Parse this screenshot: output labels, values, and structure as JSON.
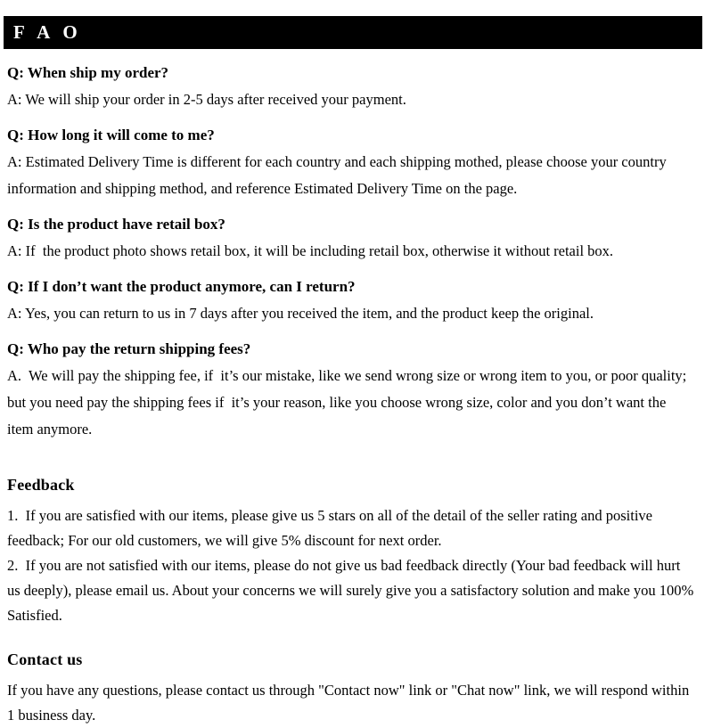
{
  "banner": {
    "title": "F A O",
    "background_color": "#000000",
    "text_color": "#ffffff"
  },
  "faq": {
    "items": [
      {
        "question": "Q: When ship my order?",
        "answer": "A: We will ship your order in 2-5 days after received your payment."
      },
      {
        "question": "Q: How long it will come to me?",
        "answer": "A: Estimated Delivery Time is different for each country and each shipping mothed, please choose your country information and shipping method, and reference Estimated Delivery Time on the page."
      },
      {
        "question": "Q: Is the product have retail box?",
        "answer": "A: If  the product photo shows retail box, it will be including retail box, otherwise it without retail box."
      },
      {
        "question": "Q: If I don’t want the product anymore, can I return?",
        "answer": "A: Yes, you can return to us in 7 days after you received the item, and the product keep the original."
      },
      {
        "question": "Q: Who pay the return shipping fees?",
        "answer": "A.  We will pay the shipping fee, if  it’s our mistake, like we send wrong size or wrong item to you, or poor quality; but you need pay the shipping fees if  it’s your reason, like you choose wrong size, color and you don’t want the item anymore."
      }
    ]
  },
  "feedback": {
    "heading": "Feedback",
    "point_1": "1.  If you are satisfied with our items, please give us 5 stars on all of the detail of the seller rating and positive feedback; For our old customers, we will give 5% discount for next order.",
    "point_2": "2.  If you are not satisfied with our items, please do not give us bad feedback directly (Your bad feedback will hurt us deeply), please email us. About your concerns we will surely give you a satisfactory solution and make you 100% Satisfied."
  },
  "contact": {
    "heading": "Contact us",
    "body": "If you have any questions, please contact us through \"Contact now\" link or \"Chat now\" link, we will respond within 1 business day."
  },
  "theme": {
    "background_color": "#ffffff",
    "text_color": "#000000"
  }
}
